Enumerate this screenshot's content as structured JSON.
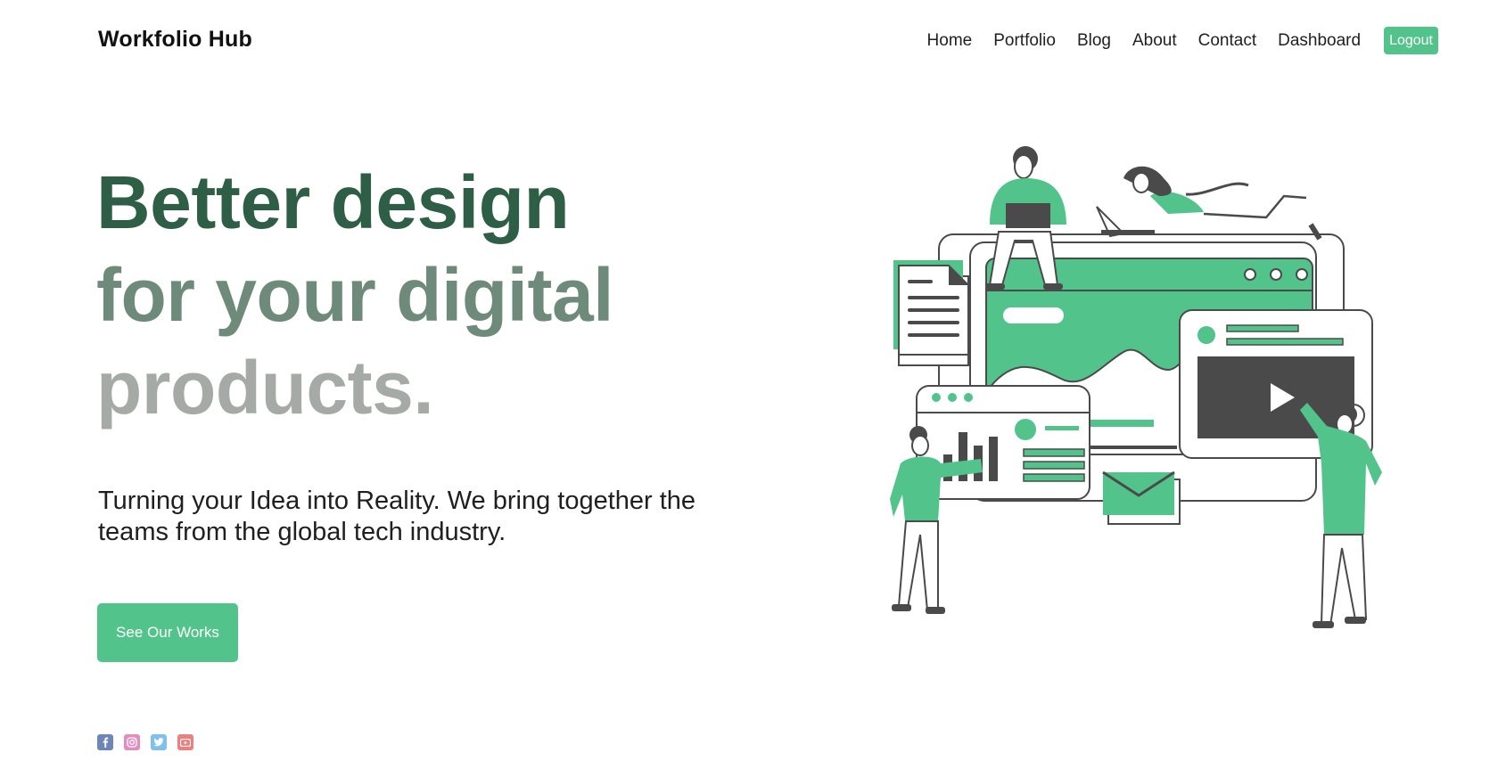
{
  "header": {
    "brand": "Workfolio Hub",
    "nav": [
      "Home",
      "Portfolio",
      "Blog",
      "About",
      "Contact",
      "Dashboard"
    ],
    "logout_label": "Logout"
  },
  "hero": {
    "title_line1": "Better design",
    "title_line2": "for your digital",
    "title_line3": "products.",
    "subtitle": "Turning your Idea into Reality. We bring together the teams from the global tech industry.",
    "cta_label": "See Our Works"
  },
  "social": {
    "icons": [
      "facebook-icon",
      "instagram-icon",
      "twitter-icon",
      "youtube-icon"
    ]
  },
  "colors": {
    "accent": "#52c38a",
    "title_dark": "#2f5e47",
    "title_mid": "#6e8a7b",
    "title_light": "#a5aaa7",
    "illustration_dark": "#4a4a4a"
  }
}
